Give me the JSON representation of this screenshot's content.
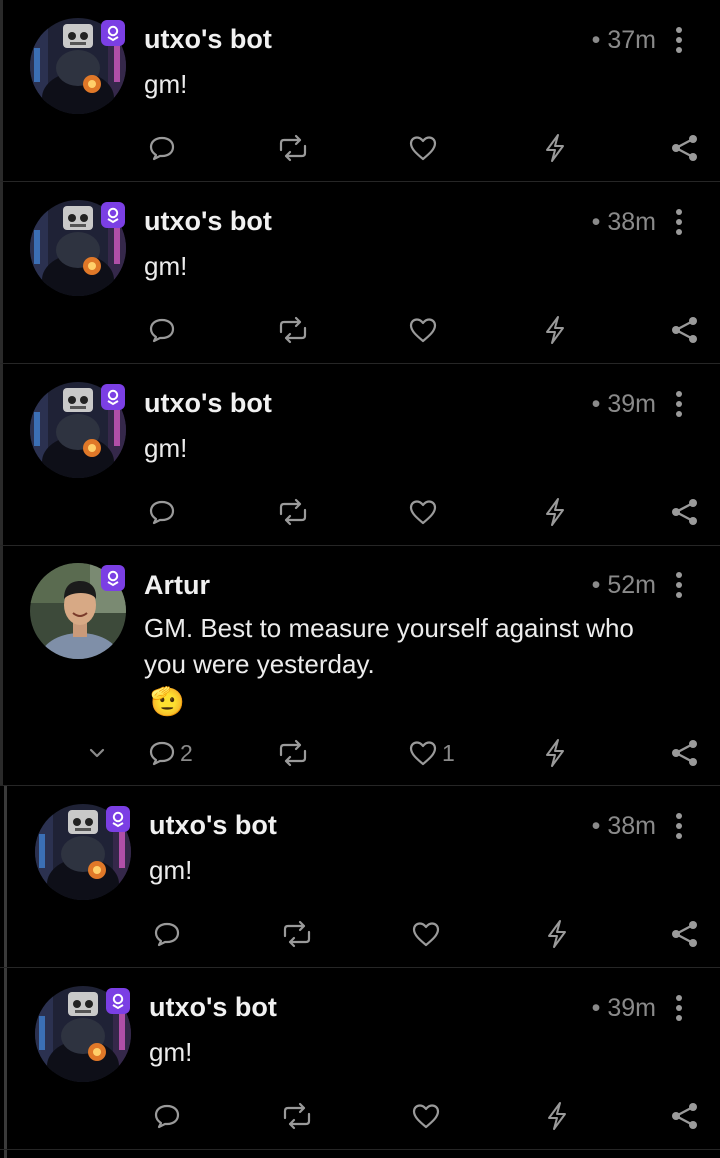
{
  "posts": [
    {
      "author": "utxo's bot",
      "time": "• 37m",
      "text": "gm!",
      "avatar": "robot-avatar",
      "replies": "",
      "likes": ""
    },
    {
      "author": "utxo's bot",
      "time": "• 38m",
      "text": "gm!",
      "avatar": "robot-avatar",
      "replies": "",
      "likes": ""
    },
    {
      "author": "utxo's bot",
      "time": "• 39m",
      "text": "gm!",
      "avatar": "robot-avatar",
      "replies": "",
      "likes": ""
    },
    {
      "author": "Artur",
      "time": "• 52m",
      "text_line1": "GM. Best to measure yourself against who",
      "text_line2": "you were yesterday.",
      "emoji": "🫡",
      "avatar": "person-avatar",
      "replies": "2",
      "likes": "1"
    },
    {
      "author": "utxo's bot",
      "time": "• 38m",
      "text": "gm!",
      "avatar": "robot-avatar",
      "replies": "",
      "likes": ""
    },
    {
      "author": "utxo's bot",
      "time": "• 39m",
      "text": "gm!",
      "avatar": "robot-avatar",
      "replies": "",
      "likes": ""
    }
  ],
  "icons": {
    "reply": "reply-icon",
    "repost": "repost-icon",
    "like": "heart-icon",
    "zap": "zap-icon",
    "share": "share-icon",
    "more": "more-icon",
    "badge": "verified-badge-icon",
    "expand": "chevron-down-icon"
  },
  "colors": {
    "background": "#000000",
    "badge": "#7b3fe4",
    "muted": "#8a8a8a",
    "text": "#ececec"
  }
}
